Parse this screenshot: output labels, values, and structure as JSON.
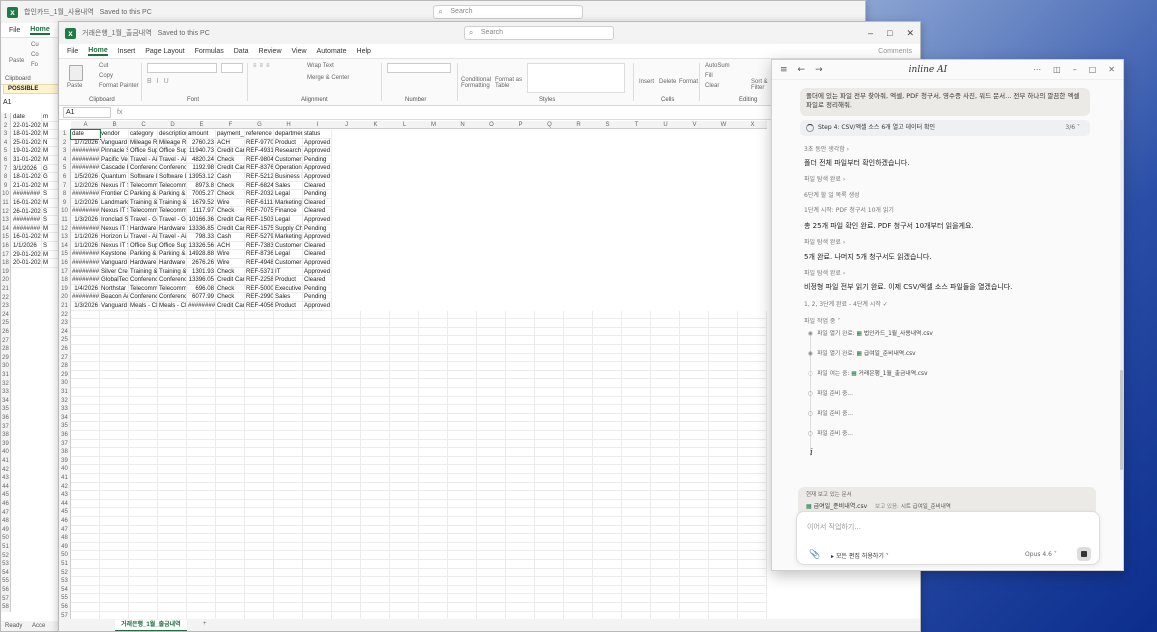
{
  "back_window": {
    "title": "합인카드_1월_사용내역",
    "saved": "Saved to this PC",
    "search_placeholder": "Search",
    "menus": [
      "File",
      "Home"
    ],
    "ribbon": [
      "Cu",
      "Co",
      "Fo",
      "Paste",
      "Clipboard",
      "POSSIBLE"
    ],
    "namebox": "A1",
    "rows": [
      [
        "date",
        "m"
      ],
      [
        "22-01-202",
        "M"
      ],
      [
        "18-01-202",
        "M"
      ],
      [
        "25-01-202",
        "N"
      ],
      [
        "19-01-202",
        "M"
      ],
      [
        "31-01-202",
        "M"
      ],
      [
        "3/1/2026",
        "G"
      ],
      [
        "18-01-202",
        "G"
      ],
      [
        "21-01-202",
        "M"
      ],
      [
        "########",
        "S"
      ],
      [
        "16-01-202",
        "M"
      ],
      [
        "26-01-202",
        "S"
      ],
      [
        "########",
        "S"
      ],
      [
        "########",
        "M"
      ],
      [
        "16-01-202",
        "M"
      ],
      [
        "1/1/2026",
        "S"
      ],
      [
        "29-01-202",
        "M"
      ],
      [
        "20-01-202",
        "M"
      ]
    ],
    "status": [
      "Ready",
      "Acce"
    ]
  },
  "main_window": {
    "title": "거래은행_1월_출금내역",
    "saved": "Saved to this PC",
    "search_placeholder": "Search",
    "menus": [
      "File",
      "Home",
      "Insert",
      "Page Layout",
      "Formulas",
      "Data",
      "Review",
      "View",
      "Automate",
      "Help"
    ],
    "comments": "Comments",
    "ribbon": {
      "cut": "Cut",
      "copy": "Copy",
      "format_painter": "Format Painter",
      "paste": "Paste",
      "clipboard": "Clipboard",
      "font": "Font",
      "alignment": "Alignment",
      "number": "Number",
      "styles": "Styles",
      "cells": "Cells",
      "editing": "Editing",
      "wrap_text": "Wrap Text",
      "merge_center": "Merge & Center",
      "conditional": "Conditional Formatting",
      "format_table": "Format as Table",
      "insert": "Insert",
      "delete": "Delete",
      "format": "Format",
      "autosum": "AutoSum",
      "fill": "Fill",
      "clear": "Clear",
      "sort": "Sort & Filter"
    },
    "namebox": "A1",
    "fx": "fx",
    "columns": [
      "A",
      "B",
      "C",
      "D",
      "E",
      "F",
      "G",
      "H",
      "I",
      "J",
      "K",
      "L",
      "M",
      "N",
      "O",
      "P",
      "Q",
      "R",
      "S",
      "T",
      "U",
      "V",
      "W",
      "X"
    ],
    "header": [
      "date",
      "vendor",
      "category",
      "description",
      "amount",
      "payment_m",
      "reference",
      "department",
      "status"
    ],
    "rows": [
      [
        "1/7/2026",
        "Vanguard (",
        "Mileage Re",
        "Mileage Re",
        "2760.23",
        "ACH",
        "REF-97707",
        "Product",
        "Approved"
      ],
      [
        "########",
        "Pinnacle S",
        "Office Sup",
        "Office Sup",
        "11940.73",
        "Credit Car",
        "REF-49314",
        "Research a",
        "Approved"
      ],
      [
        "########",
        "Pacific Ve",
        "Travel - Air",
        "Travel - Air",
        "4820.24",
        "Check",
        "REF-98042",
        "Customer",
        "Pending"
      ],
      [
        "########",
        "Cascade E",
        "Conferenc",
        "Conferenc",
        "1192.98",
        "Credit Car",
        "REF-83763",
        "Operations",
        "Approved"
      ],
      [
        "1/5/2026",
        "Quantum S",
        "Software L",
        "Software L",
        "13953.12",
        "Cash",
        "REF-52128",
        "Business D",
        "Approved"
      ],
      [
        "1/2/2026",
        "Nexus IT S",
        "Telecomm",
        "Telecomm",
        "8973.8",
        "Check",
        "REF-68243",
        "Sales",
        "Cleared"
      ],
      [
        "########",
        "Frontier C",
        "Parking &",
        "Parking &",
        "7005.27",
        "Check",
        "REF-20320",
        "Legal",
        "Pending"
      ],
      [
        "1/2/2026",
        "Landmark",
        "Training &",
        "Training &",
        "1679.52",
        "Wire",
        "REF-61111",
        "Marketing",
        "Cleared"
      ],
      [
        "########",
        "Nexus IT S",
        "Telecomm",
        "Telecomm",
        "1117.97",
        "Check",
        "REF-70750",
        "Finance",
        "Cleared"
      ],
      [
        "1/3/2026",
        "Ironclad Sc",
        "Travel - Gr",
        "Travel - Gr",
        "10166.36",
        "Credit Car",
        "REF-15031",
        "Legal",
        "Approved"
      ],
      [
        "########",
        "Nexus IT S",
        "Hardware",
        "Hardware",
        "13336.85",
        "Credit Car",
        "REF-15751",
        "Supply Cha",
        "Pending"
      ],
      [
        "1/1/2026",
        "Horizon Lo",
        "Travel - Air",
        "Travel - Air",
        "798.33",
        "Cash",
        "REF-52798",
        "Marketing",
        "Approved"
      ],
      [
        "1/1/2026",
        "Nexus IT S",
        "Office Sup",
        "Office Sup",
        "13326.56",
        "ACH",
        "REF-73832",
        "Customer",
        "Cleared"
      ],
      [
        "########",
        "Keystone L",
        "Parking &",
        "Parking &",
        "14928.88",
        "Wire",
        "REF-87367",
        "Legal",
        "Cleared"
      ],
      [
        "########",
        "Vanguard (",
        "Hardware",
        "Hardware",
        "2676.26",
        "Wire",
        "REF-49483",
        "Customer",
        "Approved"
      ],
      [
        "########",
        "Silver Cree",
        "Training &",
        "Training &",
        "1301.93",
        "Check",
        "REF-53713",
        "IT",
        "Approved"
      ],
      [
        "########",
        "GlobalTec",
        "Conferenc",
        "Conferenc",
        "13396.05",
        "Credit Car",
        "REF-22588",
        "Product",
        "Cleared"
      ],
      [
        "1/4/2026",
        "Northstar",
        "Telecomm",
        "Telecomm",
        "696.08",
        "Check",
        "REF-50004",
        "Executive",
        "Pending"
      ],
      [
        "########",
        "Beacon An",
        "Conferenc",
        "Conferenc",
        "6077.99",
        "Check",
        "REF-29902",
        "Sales",
        "Pending"
      ],
      [
        "1/3/2026",
        "Vanguard (",
        "Meals - Cli",
        "Meals - Cli",
        "########",
        "Credit Car",
        "REF-40569",
        "Product",
        "Approved"
      ]
    ],
    "row_numbers": [
      "1",
      "2",
      "3",
      "4",
      "5",
      "6",
      "7",
      "8",
      "9",
      "10",
      "11",
      "12",
      "13",
      "14",
      "15",
      "16",
      "17",
      "18",
      "19",
      "20",
      "21",
      "22",
      "23",
      "24",
      "25",
      "26",
      "27",
      "28",
      "29",
      "30",
      "31",
      "32",
      "33",
      "34",
      "35",
      "36",
      "37",
      "38",
      "39",
      "40",
      "41",
      "42",
      "43",
      "44",
      "45",
      "46",
      "47",
      "48",
      "49",
      "50",
      "51",
      "52",
      "53",
      "54",
      "55",
      "56",
      "57",
      "58"
    ],
    "sheet_tab": "거래은행_1월_출금내역",
    "add_sheet": "+"
  },
  "panel": {
    "title": "inline AI",
    "user_message": "폴더에 있는 파일 전부 찾아줘, 엑셀, PDF 청구서, 영수증 사진, 워드 문서... 전부 하나의 깔끔한 엑셀 파일로 정리해줘.",
    "step": "Step 4: CSV/엑셀 소스 6개 열고 데이터 확인",
    "step_progress": "3/6",
    "thought": "3초 동안 생각함",
    "msg1": "폴더 전체 파일부터 확인하겠습니다.",
    "tool1": "파일 탐색 완료",
    "sub1": "6단계 할 일 목록 생성",
    "sub2": "1단계 시작: PDF 청구서 10개 읽기",
    "msg2": "총 25개 파일 확인 완료. PDF 청구서 10개부터 읽을게요.",
    "tool2": "파일 탐색 완료",
    "msg3": "5개 완료. 나머지 5개 청구서도 읽겠습니다.",
    "tool3": "파일 탐색 완료",
    "msg4": "비정형 파일 전부 읽기 완료. 이제 CSV/엑셀 소스 파일들을 열겠습니다.",
    "done_steps": "1, 2, 3단계 완료 - 4단계 시작",
    "task_header": "파일 작업 중",
    "tasks": [
      {
        "label": "파일 열기 완료:",
        "file": "법인카드_1월_사용내역.csv"
      },
      {
        "label": "파일 열기 완료:",
        "file": "급여일_준비내역.csv"
      },
      {
        "label": "파일 여는 중:",
        "file": "거래은행_1월_출금내역.csv"
      },
      {
        "label": "파일 준비 중...",
        "file": ""
      },
      {
        "label": "파일 준비 중...",
        "file": ""
      },
      {
        "label": "파일 준비 중...",
        "file": ""
      }
    ],
    "ctx_label": "현재 보고 있는 문서",
    "ctx_file": "급여일_준비내역.csv",
    "ctx_sheet_label": "보고 있음:",
    "ctx_sheet": "시트 급여일_준비내역",
    "input_placeholder": "이어서 작업하기...",
    "permission": "모든 편집 허용하기",
    "model": "Opus 4.6"
  }
}
